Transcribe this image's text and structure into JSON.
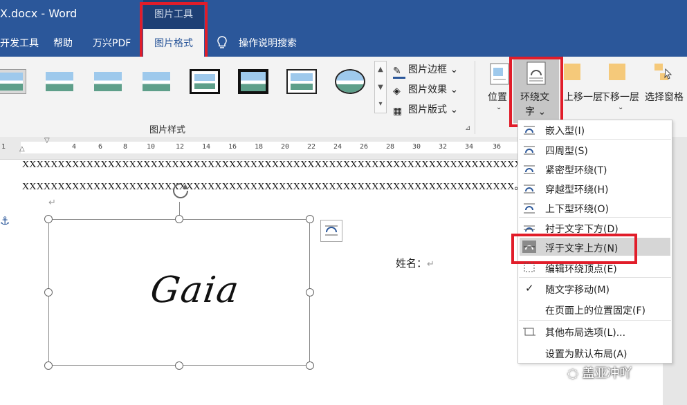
{
  "window": {
    "title": "X.docx  -  Word"
  },
  "context_tab_group": "图片工具",
  "tabs": {
    "dev": "开发工具",
    "help": "帮助",
    "wanxing": "万兴PDF",
    "picture_format": "图片格式",
    "tell_me": "操作说明搜索"
  },
  "ribbon": {
    "commands": {
      "border": "图片边框",
      "effects": "图片效果",
      "layout": "图片版式"
    },
    "group_picture_styles": "图片样式",
    "position": "位置",
    "wrap_text_line1": "环绕文",
    "wrap_text_line2": "字",
    "bring_forward": "上移一层",
    "send_backward": "下移一层",
    "selection_pane": "选择窗格"
  },
  "ruler": {
    "ticks": [
      "1",
      "4",
      "6",
      "8",
      "10",
      "12",
      "14",
      "16",
      "18",
      "20",
      "22",
      "24",
      "26",
      "28",
      "30",
      "32",
      "34",
      "36"
    ]
  },
  "document": {
    "line1": "XXXXXXXXXXXXXXXXXXXXXXXXXXXXXXXXXXXXXXXXXXXXXXXXXXXXXXXXXXXXXXXXXXXXXXXXXX",
    "line2": "XXXXXXXXXXXXXXXXXXXXXXXXXXXXXXXXXXXXXXXXXXXXXXXXXXXXXXXXXXXXXXXXXXXXX。",
    "name_label": "姓名：",
    "signature": "Gaia",
    "paragraph_mark": "↵"
  },
  "wrap_menu": {
    "items": [
      "嵌入型(I)",
      "四周型(S)",
      "紧密型环绕(T)",
      "穿越型环绕(H)",
      "上下型环绕(O)",
      "衬于文字下方(D)",
      "浮于文字上方(N)",
      "编辑环绕顶点(E)",
      "随文字移动(M)",
      "在页面上的位置固定(F)",
      "其他布局选项(L)...",
      "设置为默认布局(A)"
    ],
    "checked": "✓"
  },
  "watermark": "盖亚冲吖",
  "colors": {
    "accent": "#2b579a",
    "highlight": "#e11d2a"
  }
}
